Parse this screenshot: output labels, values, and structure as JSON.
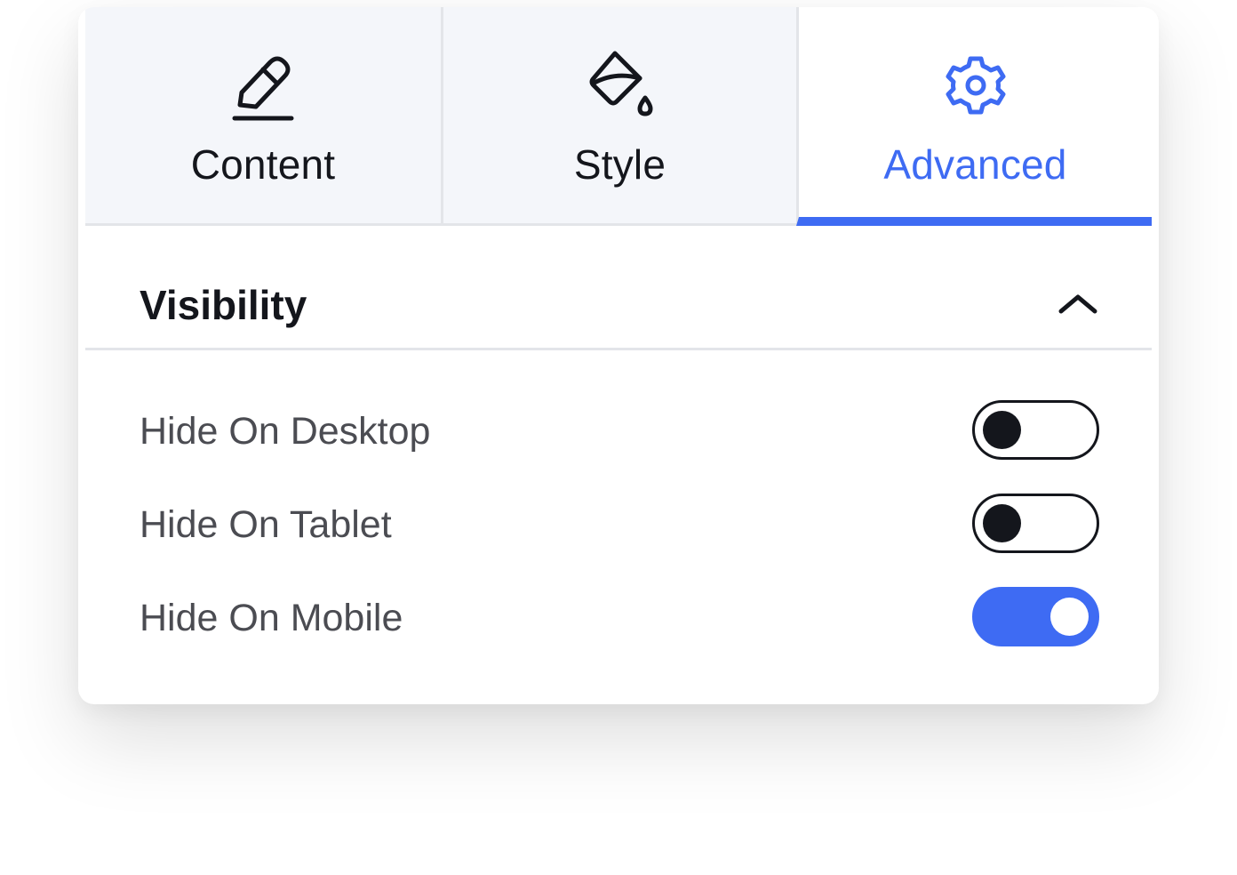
{
  "tabs": [
    {
      "label": "Content",
      "icon": "pencil-icon",
      "active": false
    },
    {
      "label": "Style",
      "icon": "paint-bucket-icon",
      "active": false
    },
    {
      "label": "Advanced",
      "icon": "gear-icon",
      "active": true
    }
  ],
  "section": {
    "title": "Visibility",
    "icon": "chevron-up-icon",
    "expanded": true
  },
  "settings": [
    {
      "label": "Hide On Desktop",
      "enabled": false
    },
    {
      "label": "Hide On Tablet",
      "enabled": false
    },
    {
      "label": "Hide On Mobile",
      "enabled": true
    }
  ],
  "colors": {
    "accent": "#3e6bf3",
    "text": "#14161c",
    "muted_text": "#4b4c52",
    "tab_bg": "#f4f6fa",
    "divider": "#e3e5e9"
  }
}
